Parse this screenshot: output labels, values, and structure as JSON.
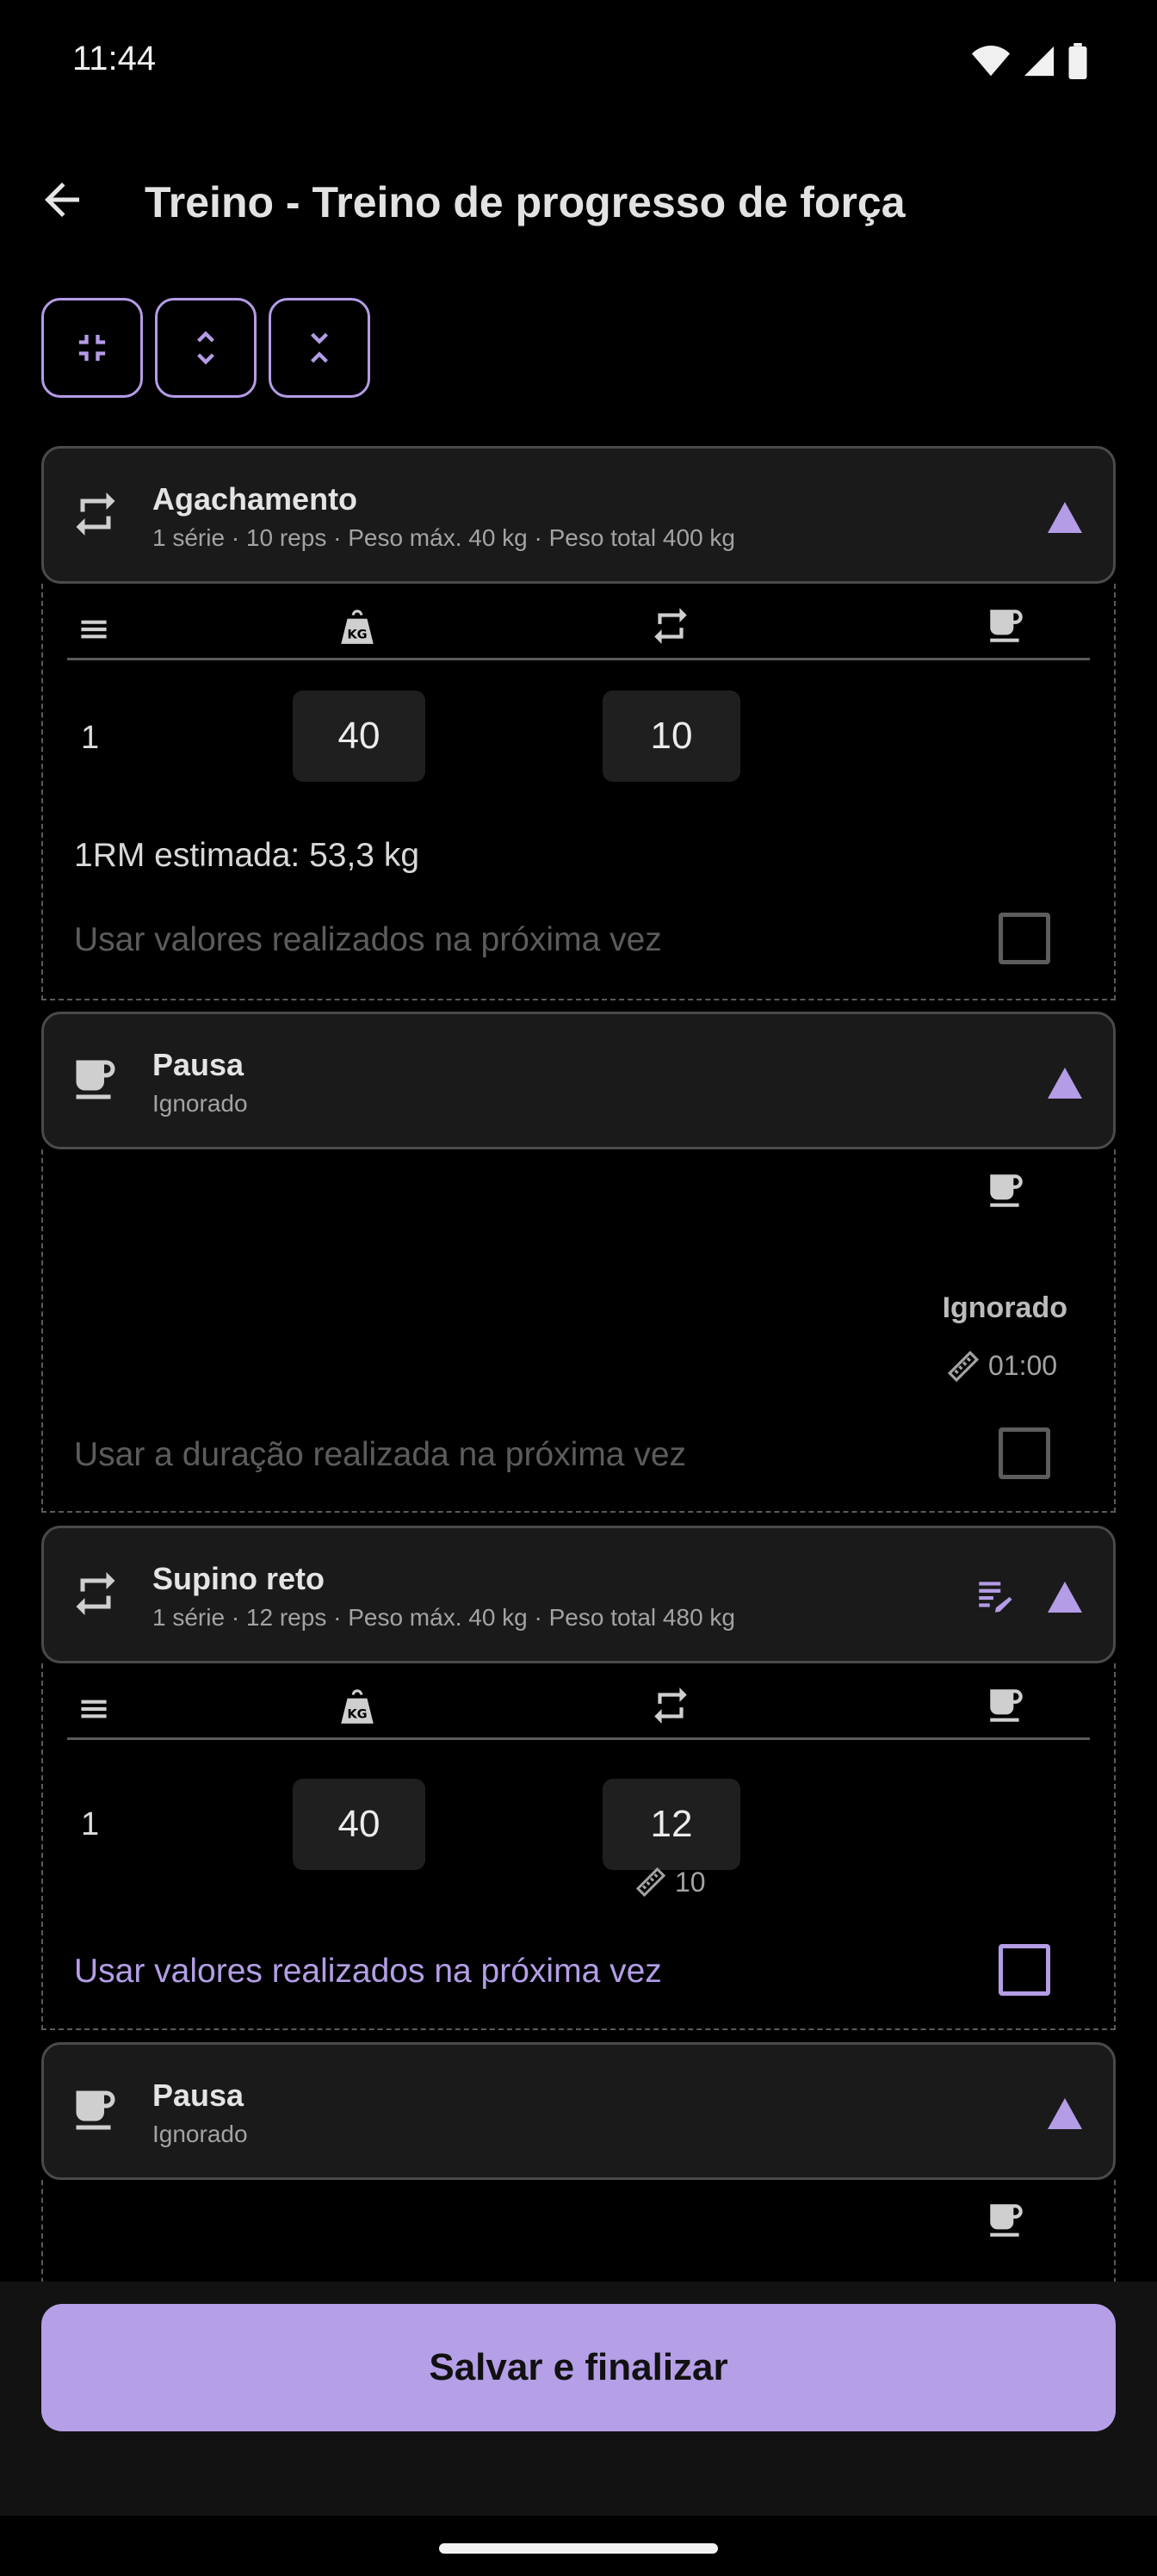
{
  "status_bar": {
    "time": "11:44"
  },
  "header": {
    "title": "Treino - Treino de progresso de força"
  },
  "toolbar": {
    "buttons": [
      {
        "name": "collapse-all",
        "icon": "collapse-icon"
      },
      {
        "name": "expand-vertical",
        "icon": "unfold-more-icon"
      },
      {
        "name": "collapse-vertical",
        "icon": "unfold-less-icon"
      }
    ]
  },
  "exercises": [
    {
      "title": "Agachamento",
      "subtitle": "1 série · 10 reps · Peso máx. 40 kg · Peso total 400 kg",
      "sets": [
        {
          "index": "1",
          "weight": "40",
          "reps": "10"
        }
      ],
      "estimate": "1RM estimada: 53,3 kg",
      "option_label": "Usar valores realizados na próxima vez"
    },
    {
      "title": "Supino reto",
      "subtitle": "1 série · 12 reps · Peso máx. 40 kg · Peso total 480 kg",
      "sets": [
        {
          "index": "1",
          "weight": "40",
          "reps": "12",
          "planned_reps": "10"
        }
      ],
      "option_label": "Usar valores realizados na próxima vez"
    }
  ],
  "pauses": [
    {
      "title": "Pausa",
      "subtitle": "Ignorado",
      "status": "Ignorado",
      "planned": "01:00",
      "option_label": "Usar a duração realizada na próxima vez"
    },
    {
      "title": "Pausa",
      "subtitle": "Ignorado"
    }
  ],
  "footer": {
    "save_label": "Salvar e finalizar"
  },
  "colors": {
    "accent": "#b49ce6",
    "background": "#000000",
    "card": "#1a1a1a"
  }
}
